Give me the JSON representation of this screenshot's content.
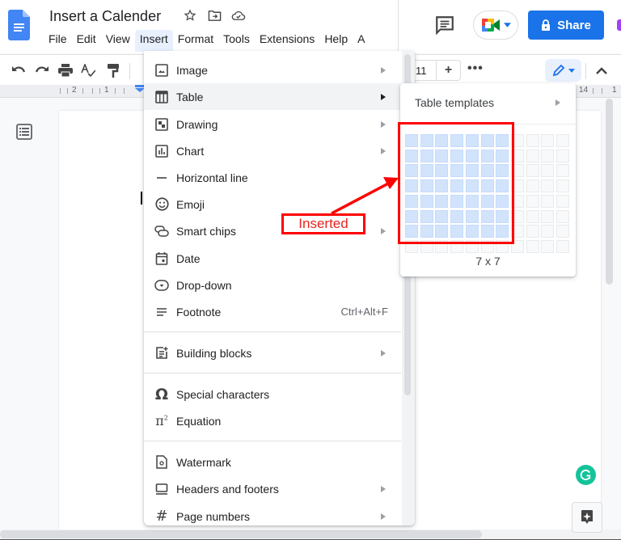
{
  "header": {
    "doc_title": "Insert a Calender",
    "menu": [
      "File",
      "Edit",
      "View",
      "Insert",
      "Format",
      "Tools",
      "Extensions",
      "Help",
      "A"
    ],
    "active_menu": "Insert",
    "share_label": "Share"
  },
  "toolbar": {
    "font_size": "11",
    "plus": "+",
    "more": "•••"
  },
  "ruler": {
    "left_numbers": [
      "2",
      "1"
    ],
    "right_numbers": [
      "14",
      "1"
    ]
  },
  "insert_menu": {
    "items": [
      {
        "label": "Image",
        "icon": "image-icon",
        "submenu": true
      },
      {
        "label": "Table",
        "icon": "table-icon",
        "submenu": true,
        "highlighted": true
      },
      {
        "label": "Drawing",
        "icon": "drawing-icon",
        "submenu": true
      },
      {
        "label": "Chart",
        "icon": "chart-icon",
        "submenu": true
      },
      {
        "label": "Horizontal line",
        "icon": "horizontal-line-icon",
        "submenu": false
      },
      {
        "label": "Emoji",
        "icon": "emoji-icon",
        "submenu": false
      },
      {
        "label": "Smart chips",
        "icon": "smart-chips-icon",
        "submenu": true
      },
      {
        "label": "Date",
        "icon": "calendar-icon",
        "submenu": false
      },
      {
        "label": "Drop-down",
        "icon": "dropdown-icon",
        "submenu": false
      },
      {
        "label": "Footnote",
        "icon": "footnote-icon",
        "submenu": false,
        "shortcut": "Ctrl+Alt+F"
      },
      {
        "label": "Building blocks",
        "icon": "building-blocks-icon",
        "submenu": true
      },
      {
        "label": "Special characters",
        "icon": "omega-icon",
        "submenu": false
      },
      {
        "label": "Equation",
        "icon": "pi-icon",
        "submenu": false
      },
      {
        "label": "Watermark",
        "icon": "watermark-icon",
        "submenu": false
      },
      {
        "label": "Headers and footers",
        "icon": "headers-footers-icon",
        "submenu": true
      },
      {
        "label": "Page numbers",
        "icon": "hash-icon",
        "submenu": true
      }
    ]
  },
  "table_submenu": {
    "templates_label": "Table templates",
    "grid_columns": 11,
    "grid_rows": 8,
    "selected_columns": 7,
    "selected_rows": 7,
    "size_label": "7 x 7"
  },
  "annotation": {
    "label": "Inserted",
    "color": "#ff0000"
  },
  "colors": {
    "accent": "#1a73e8",
    "selection": "#d2e3fc",
    "grammarly": "#15c39a"
  }
}
